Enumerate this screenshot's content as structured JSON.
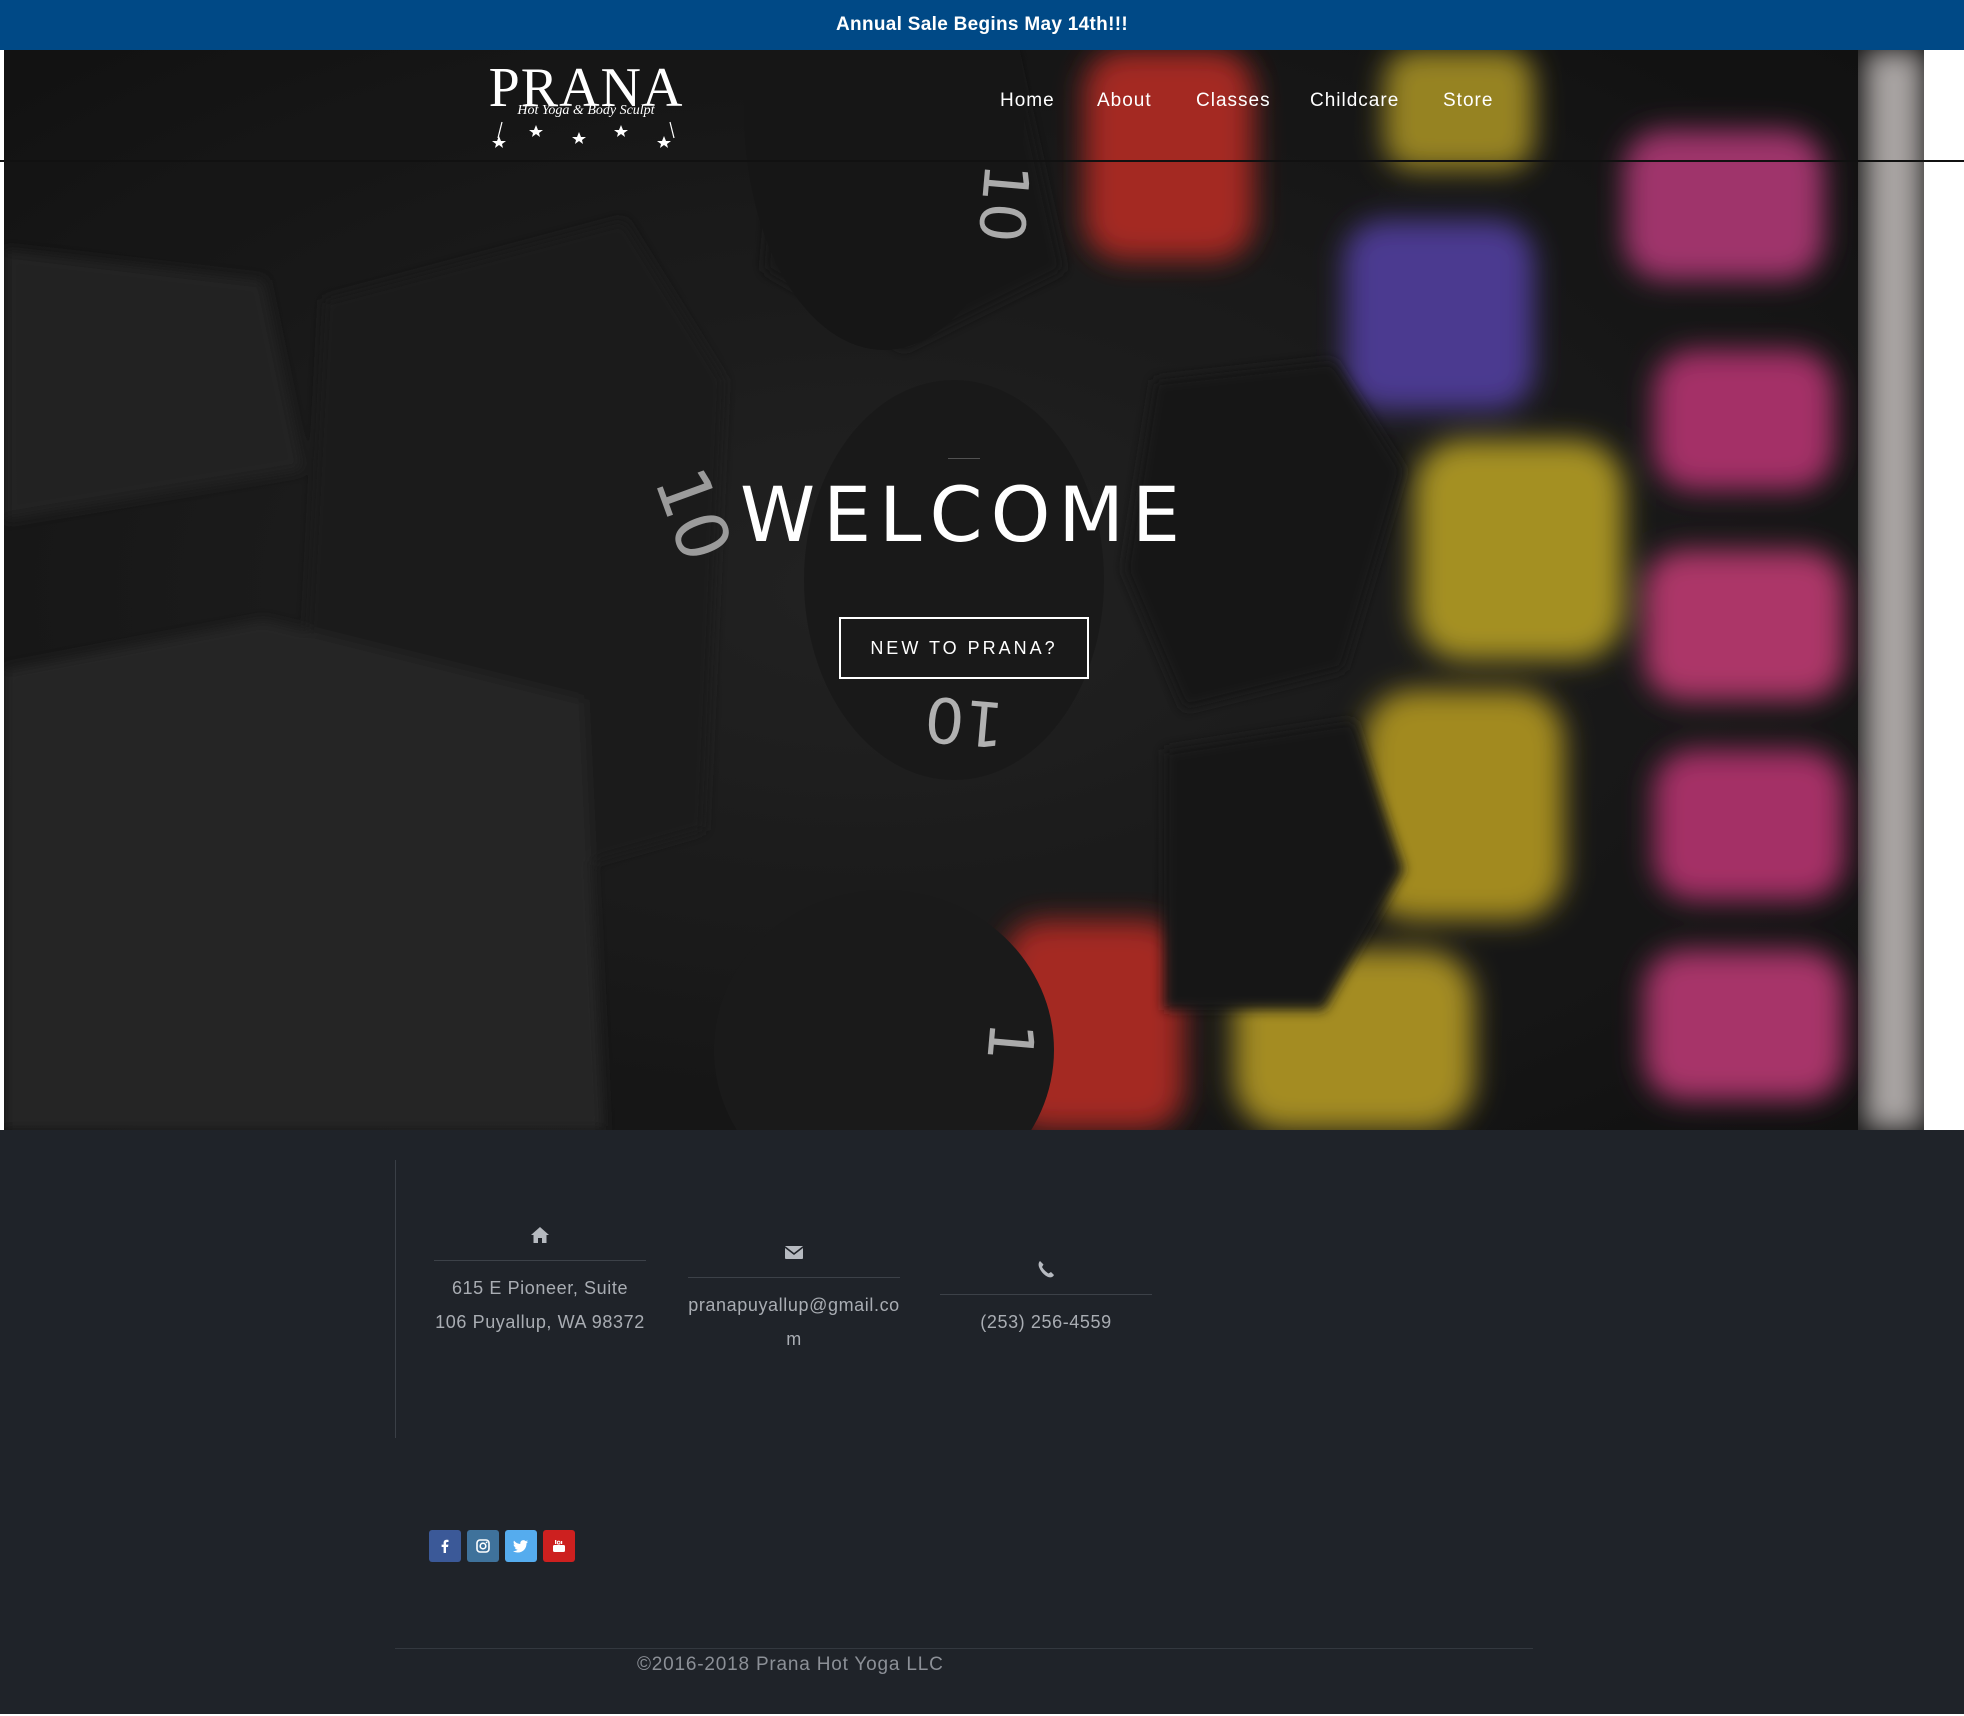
{
  "announcement": {
    "text": "Annual Sale Begins May 14th!!!",
    "background": "#004986"
  },
  "brand": {
    "name": "PRANA",
    "tagline": "Hot Yoga & Body Sculpt"
  },
  "nav": {
    "items": [
      {
        "label": "Home"
      },
      {
        "label": "About"
      },
      {
        "label": "Classes"
      },
      {
        "label": "Childcare"
      },
      {
        "label": "Store"
      }
    ]
  },
  "hero": {
    "heading": "WELCOME",
    "cta_label": "NEW TO PRANA?"
  },
  "contact": {
    "address": {
      "icon": "home-icon",
      "text": "615 E Pioneer, Suite 106 Puyallup, WA 98372"
    },
    "email": {
      "icon": "envelope-icon",
      "text": "pranapuyallup@gmail.com"
    },
    "phone": {
      "icon": "phone-icon",
      "text": "(253) 256-4559"
    }
  },
  "social": [
    {
      "icon": "facebook-icon",
      "color": "#3b5998"
    },
    {
      "icon": "instagram-icon",
      "color": "#3f729b"
    },
    {
      "icon": "twitter-icon",
      "color": "#55acee"
    },
    {
      "icon": "youtube-icon",
      "color": "#cd201f"
    }
  ],
  "footer": {
    "copyright": "©2016-2018 Prana Hot Yoga LLC",
    "background": "#1f2329"
  }
}
